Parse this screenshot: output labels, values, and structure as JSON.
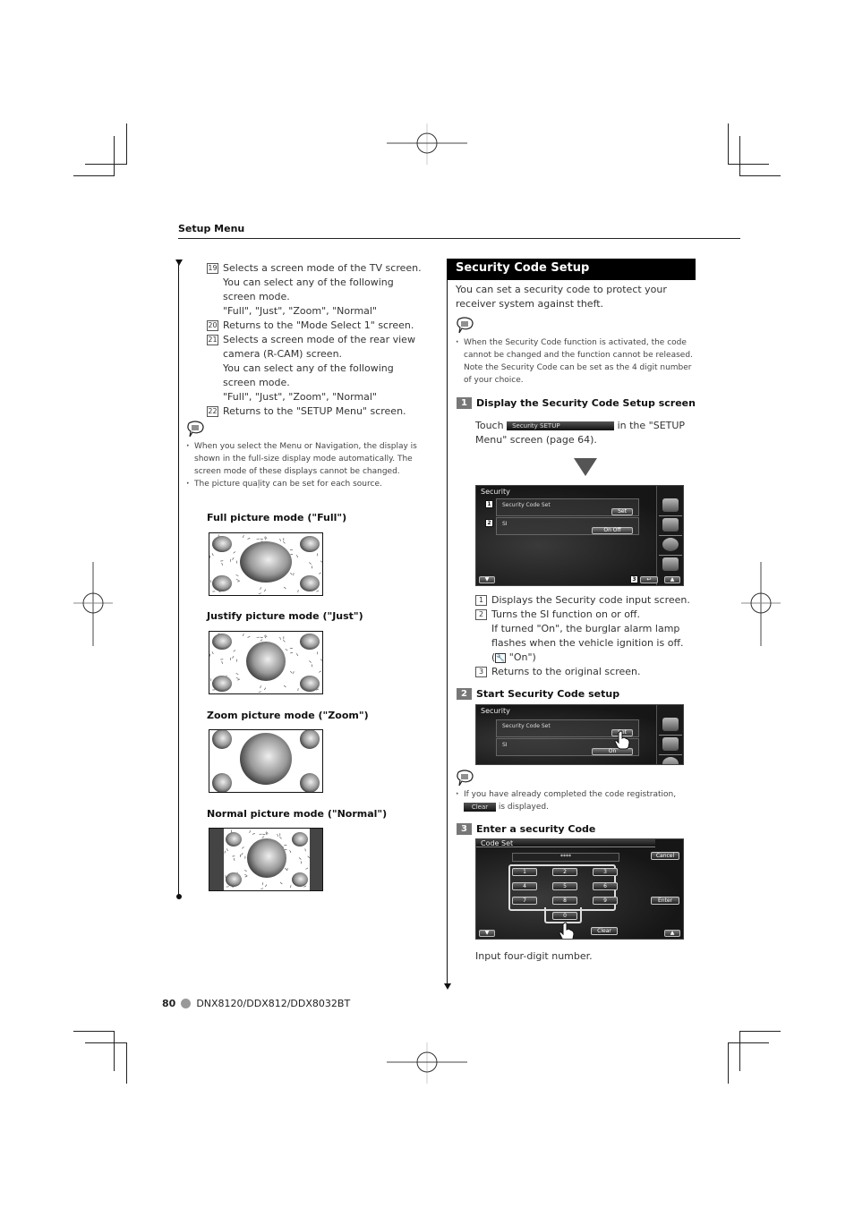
{
  "header": {
    "section": "Setup Menu"
  },
  "left": {
    "items": [
      {
        "num": "19",
        "lines": [
          "Selects a screen mode of the TV screen.",
          "You can select any of the following screen mode.",
          "\"Full\", \"Just\", \"Zoom\", \"Normal\""
        ]
      },
      {
        "num": "20",
        "lines": [
          "Returns to the \"Mode Select 1\" screen."
        ]
      },
      {
        "num": "21",
        "lines": [
          "Selects a screen mode of the rear view camera (R-CAM) screen.",
          "You can select any of the following screen mode.",
          "\"Full\", \"Just\", \"Zoom\", \"Normal\""
        ]
      },
      {
        "num": "22",
        "lines": [
          "Returns to the \"SETUP Menu\" screen."
        ]
      }
    ],
    "notes": [
      "When you select the Menu or Navigation, the display is shown in the full-size display mode automatically. The screen mode of these displays cannot be changed.",
      "The picture quaļity can be set for each source."
    ],
    "picture_modes": [
      {
        "label": "Full picture mode (\"Full\")",
        "mode": "full"
      },
      {
        "label": "Justify picture mode (\"Just\")",
        "mode": "just"
      },
      {
        "label": "Zoom picture mode (\"Zoom\")",
        "mode": "zoom"
      },
      {
        "label": "Normal picture mode (\"Normal\")",
        "mode": "normal"
      }
    ]
  },
  "right": {
    "title": "Security Code Setup",
    "intro": "You can set a security code to protect your receiver system against theft.",
    "note": "When the Security Code function is activated, the code cannot be changed and the function cannot be released. Note the Security Code can be set as the 4 digit number of your choice.",
    "step1": {
      "num": "1",
      "heading": "Display the Security Code Setup screen",
      "touch_prefix": "Touch",
      "button_label": "Security SETUP",
      "touch_suffix": "in the \"SETUP Menu\" screen (page 64)."
    },
    "screen1": {
      "title": "Security",
      "rows": [
        {
          "callout": "1",
          "label": "Security Code Set",
          "button": "Set"
        },
        {
          "callout": "2",
          "label": "SI",
          "options": [
            "On",
            "Off"
          ]
        }
      ],
      "callout3": "3"
    },
    "callouts": [
      {
        "num": "1",
        "lines": [
          "Displays the Security code input screen."
        ]
      },
      {
        "num": "2",
        "lines": [
          "Turns the SI function on or off.",
          "If turned \"On\", the burglar alarm lamp flashes when the vehicle ignition is off.",
          "\"On\")"
        ]
      },
      {
        "num": "3",
        "lines": [
          "Returns to the original screen."
        ]
      }
    ],
    "step2": {
      "num": "2",
      "heading": "Start Security Code setup"
    },
    "screen2": {
      "title": "Security",
      "row1_label": "Security Code Set",
      "row1_button": "Set",
      "row2_label": "SI",
      "row2_option": "On"
    },
    "note2_prefix": "If you have already completed the code registration,",
    "note2_button": "Clear",
    "note2_suffix": "is displayed.",
    "step3": {
      "num": "3",
      "heading": "Enter a security Code"
    },
    "screen3": {
      "title": "Code Set",
      "display_value": "****",
      "cancel": "Cancel",
      "enter": "Enter",
      "clear": "Clear",
      "keys": [
        "1",
        "2",
        "3",
        "4",
        "5",
        "6",
        "7",
        "8",
        "9",
        "0"
      ]
    },
    "step3_caption": "Input four-digit number."
  },
  "footer": {
    "page": "80",
    "models": "DNX8120/DDX812/DDX8032BT"
  }
}
